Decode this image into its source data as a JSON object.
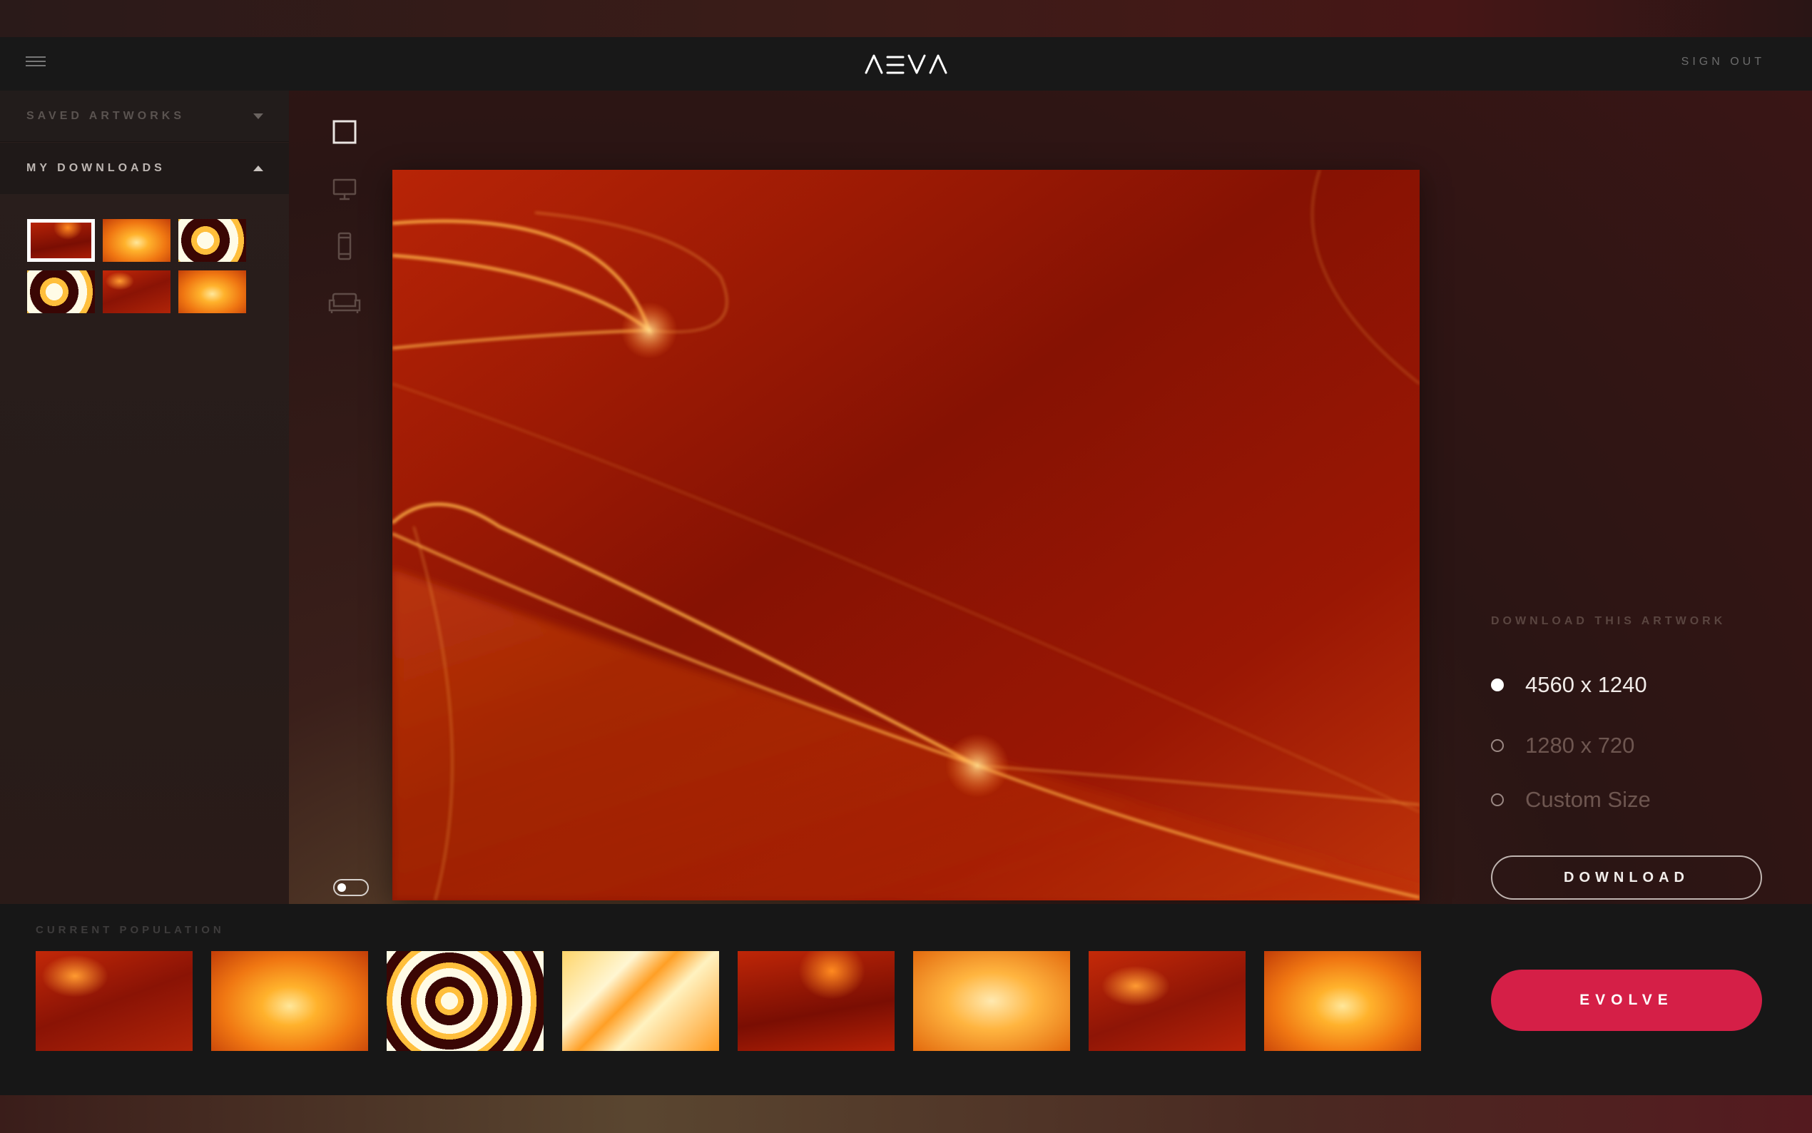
{
  "app": {
    "logo_text": "AEVA",
    "sign_out": "SIGN OUT"
  },
  "sidebar": {
    "saved_label": "SAVED ARTWORKS",
    "downloads_label": "MY DOWNLOADS",
    "downloads": [
      {
        "style": "a5",
        "selected": true
      },
      {
        "style": "a2",
        "selected": false
      },
      {
        "style": "a3",
        "selected": false
      },
      {
        "style": "a3",
        "selected": false
      },
      {
        "style": "a1",
        "selected": false
      },
      {
        "style": "a2",
        "selected": false
      }
    ]
  },
  "tools": [
    "square-frame-icon",
    "desktop-icon",
    "phone-icon",
    "sofa-icon"
  ],
  "download_panel": {
    "title": "DOWNLOAD THIS ARTWORK",
    "options": [
      {
        "label": "4560 x 1240",
        "selected": true
      },
      {
        "label": "1280 x 720",
        "selected": false
      },
      {
        "label": "Custom Size",
        "selected": false
      }
    ],
    "button": "DOWNLOAD"
  },
  "population": {
    "title": "CURRENT POPULATION",
    "items": [
      "a1",
      "a2",
      "a3",
      "a4",
      "a5",
      "a6",
      "a7",
      "a2"
    ],
    "evolve": "EVOLVE"
  },
  "colors": {
    "accent": "#d51f47",
    "header_bg": "#181818",
    "artwork_base": "#b21e04"
  }
}
